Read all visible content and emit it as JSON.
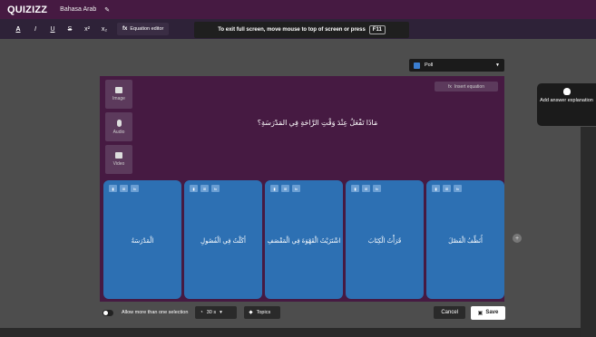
{
  "header": {
    "logo": "QUIZIZZ",
    "title": "Bahasa Arab"
  },
  "format_toolbar": {
    "buttons": [
      "A",
      "I",
      "U",
      "S",
      "x²",
      "x₂"
    ],
    "equation_label": "Equation editor",
    "equation_icon_text": "fx"
  },
  "fullscreen_banner": {
    "text": "To exit full screen, move mouse to top of screen or press",
    "key": "F11"
  },
  "question_type": {
    "label": "Poll"
  },
  "editor": {
    "media": [
      {
        "label": "Image",
        "icon": "image-icon"
      },
      {
        "label": "Audio",
        "icon": "microphone-icon"
      },
      {
        "label": "Video",
        "icon": "video-icon"
      }
    ],
    "insert_equation": "Insert equation",
    "question": "مَاذَا تَفْعَلُ عِنْدَ وَقْتِ الرَّاحَةِ فِي المَدْرَسَةِ؟",
    "option_tools": [
      "▮",
      "⊞",
      "fx"
    ],
    "options": [
      "الْمَدْرَسَةُ",
      "أَكَلْتُ فِي الْفُصُولِ",
      "اشْتَرَيْتُ الْقَهْوَةَ فِي الْمَقْصَفِ",
      "قَرَأْتُ الْكِتَابَ",
      "أُنَظِّفُ الْفَصْلَ"
    ]
  },
  "side_panel": {
    "label": "Add answer explanation"
  },
  "bottom": {
    "multiple_label": "Allow more than one selection",
    "time": "30 s",
    "topics": "Topics",
    "cancel": "Cancel",
    "save": "Save"
  }
}
